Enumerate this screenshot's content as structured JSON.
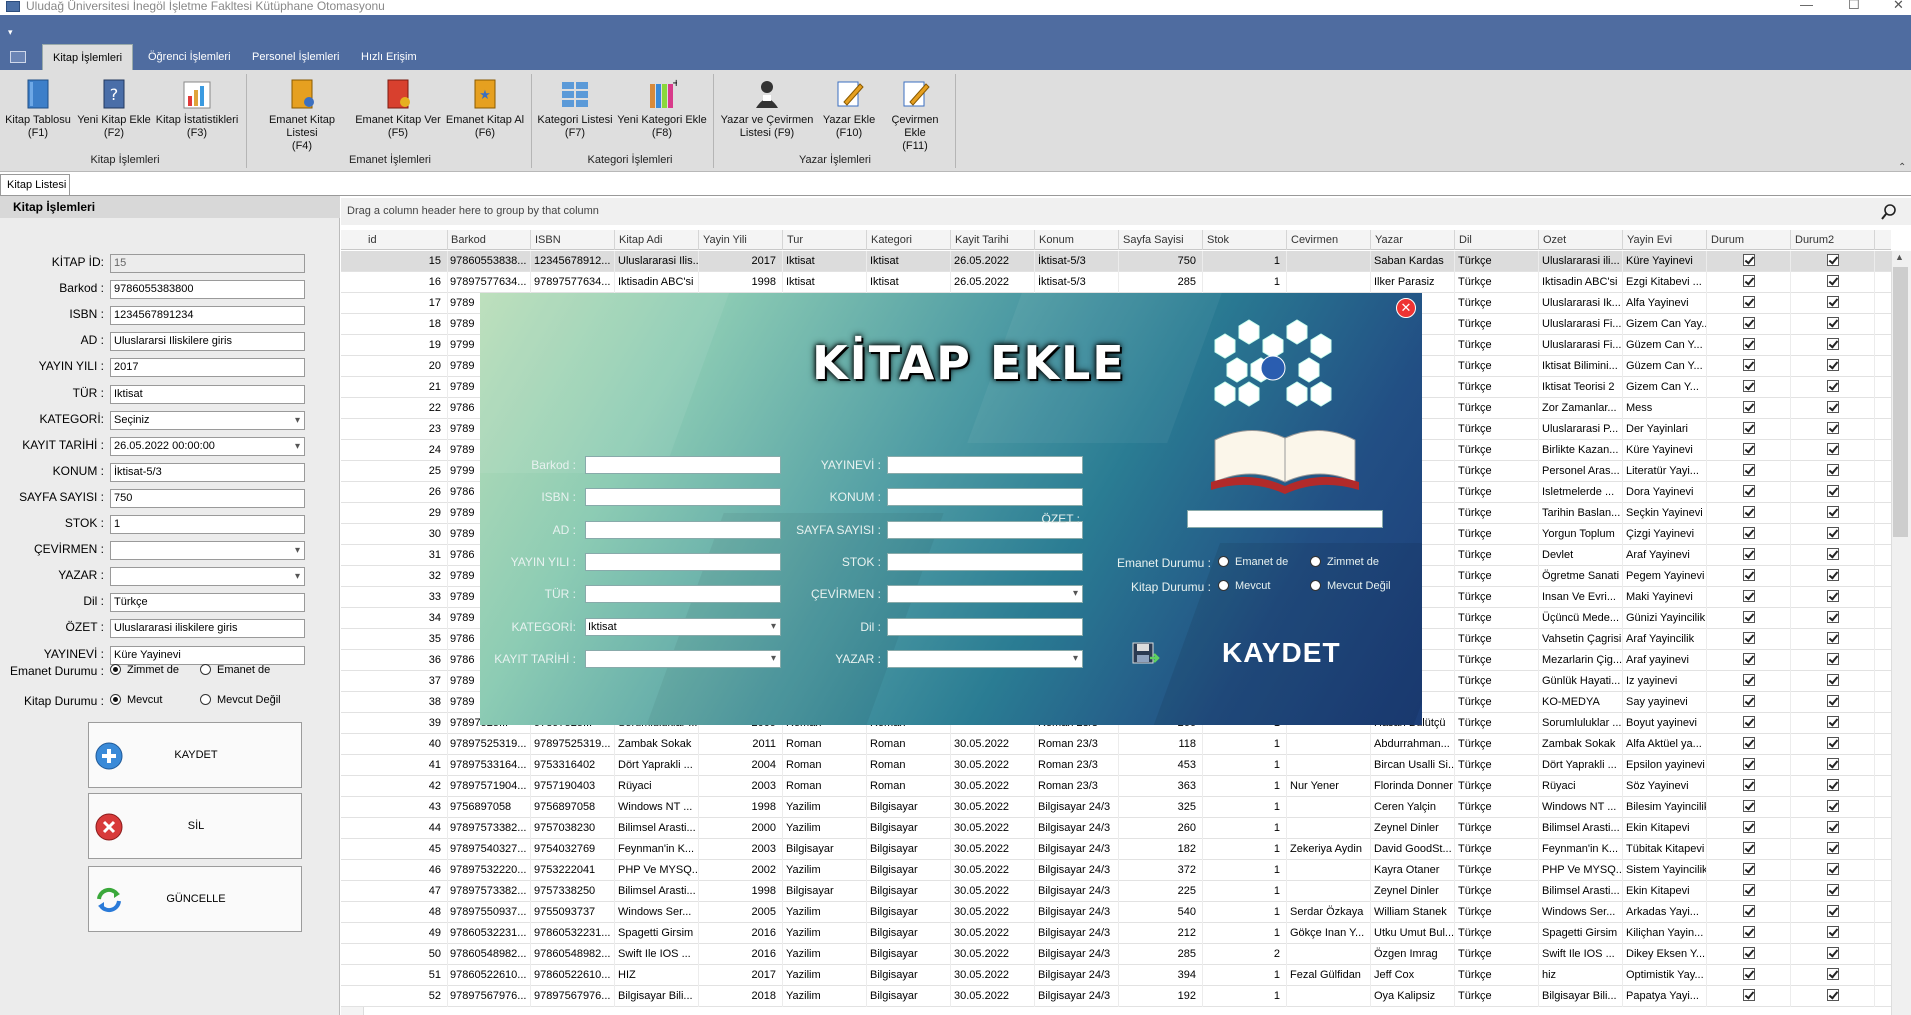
{
  "window": {
    "title": "Uludağ Üniversitesi İnegöl İşletme Fakltesi Kütüphane Otomasyonu"
  },
  "ribbon": {
    "qat": "▾",
    "tabs": [
      "Kitap İşlemleri",
      "Öğrenci İşlemleri",
      "Personel İşlemleri",
      "Hızlı Erişim"
    ],
    "buttons": [
      {
        "l1": "Kitap Tablosu",
        "l2": "(F1)"
      },
      {
        "l1": "Yeni Kitap Ekle",
        "l2": "(F2)"
      },
      {
        "l1": "Kitap İstatistikleri",
        "l2": "(F3)"
      },
      {
        "l1": "Emanet Kitap Listesi",
        "l2": "(F4)"
      },
      {
        "l1": "Emanet Kitap Ver",
        "l2": "(F5)"
      },
      {
        "l1": "Emanet Kitap Al",
        "l2": "(F6)"
      },
      {
        "l1": "Kategori Listesi",
        "l2": "(F7)"
      },
      {
        "l1": "Yeni Kategori Ekle",
        "l2": "(F8)"
      },
      {
        "l1": "Yazar ve Çevirmen",
        "l2": "Listesi (F9)"
      },
      {
        "l1": "Yazar Ekle",
        "l2": "(F10)"
      },
      {
        "l1": "Çevirmen Ekle",
        "l2": "(F11)"
      }
    ],
    "groups": [
      "Kitap İşlemleri",
      "Emanet İşlemleri",
      "Kategori İşlemleri",
      "Yazar İşlemleri"
    ]
  },
  "doctab": "Kitap Listesi",
  "left": {
    "header": "Kitap İşlemleri",
    "fields": [
      {
        "label": "KİTAP İD:",
        "value": "15"
      },
      {
        "label": "Barkod :",
        "value": "9786055383800"
      },
      {
        "label": "ISBN :",
        "value": "1234567891234"
      },
      {
        "label": "AD :",
        "value": "Uluslararsi Iliskilere giris"
      },
      {
        "label": "YAYIN YILI :",
        "value": "2017"
      },
      {
        "label": "TÜR :",
        "value": "Iktisat"
      },
      {
        "label": "KATEGORİ:",
        "value": "Seçiniz"
      },
      {
        "label": "KAYIT TARİHİ :",
        "value": "26.05.2022 00:00:00"
      },
      {
        "label": "KONUM :",
        "value": "İktisat-5/3"
      },
      {
        "label": "SAYFA SAYISI :",
        "value": "750"
      },
      {
        "label": "STOK :",
        "value": "1"
      },
      {
        "label": "ÇEVİRMEN :",
        "value": ""
      },
      {
        "label": "YAZAR :",
        "value": ""
      },
      {
        "label": "Dil :",
        "value": "Türkçe"
      },
      {
        "label": "ÖZET :",
        "value": "Uluslararasi iliskilere giris"
      },
      {
        "label": "YAYINEVİ :",
        "value": "Küre Yayinevi"
      }
    ],
    "emanet_label": "Emanet Durumu :",
    "emanet_opt1": "Zimmet de",
    "emanet_opt2": "Emanet de",
    "kitap_label": "Kitap Durumu :",
    "kitap_opt1": "Mevcut",
    "kitap_opt2": "Mevcut Değil",
    "btn_kaydet": "KAYDET",
    "btn_sil": "SİL",
    "btn_guncelle": "GÜNCELLE"
  },
  "grid": {
    "group_hint": "Drag a column header here to group by that column",
    "columns": [
      "id",
      "Barkod",
      "ISBN",
      "Kitap Adi",
      "Yayin Yili",
      "Tur",
      "Kategori",
      "Kayit Tarihi",
      "Konum",
      "Sayfa Sayisi",
      "Stok",
      "Cevirmen",
      "Yazar",
      "Dil",
      "Ozet",
      "Yayin Evi",
      "Durum",
      "Durum2"
    ],
    "rows": [
      [
        "15",
        "97860553838...",
        "12345678912...",
        "Uluslararasi Ilis...",
        "2017",
        "Iktisat",
        "Iktisat",
        "26.05.2022",
        "İktisat-5/3",
        "750",
        "1",
        "",
        "Saban Kardas",
        "Türkçe",
        "Uluslararasi ili...",
        "Küre Yayinevi"
      ],
      [
        "16",
        "97897577634...",
        "97897577634...",
        "Iktisadin ABC'si",
        "1998",
        "Iktisat",
        "Iktisat",
        "26.05.2022",
        "İktisat-5/3",
        "285",
        "1",
        "",
        "Ilker Parasiz",
        "Türkçe",
        "Iktisadin ABC'si",
        "Ezgi Kitabevi ..."
      ],
      [
        "17",
        "9789",
        "",
        "",
        "",
        "",
        "",
        "",
        "",
        "",
        "",
        "",
        "rk",
        "Türkçe",
        "Uluslararasi Ik...",
        "Alfa Yayinevi"
      ],
      [
        "18",
        "9789",
        "",
        "",
        "",
        "",
        "",
        "",
        "",
        "",
        "",
        "",
        "doglu",
        "Türkçe",
        "Uluslararasi Fi...",
        "Gizem Can Yay..."
      ],
      [
        "19",
        "9799",
        "",
        "",
        "",
        "",
        "",
        "",
        "",
        "",
        "",
        "",
        "doglu",
        "Türkçe",
        "Uluslararasi Fi...",
        "Güzem Can Y..."
      ],
      [
        "20",
        "9789",
        "",
        "",
        "",
        "",
        "",
        "",
        "",
        "",
        "",
        "",
        "doglu",
        "Türkçe",
        "Iktisat Bilimini...",
        "Güzem Can Y..."
      ],
      [
        "21",
        "9789",
        "",
        "",
        "",
        "",
        "",
        "",
        "",
        "",
        "",
        "",
        "sz",
        "Türkçe",
        "Iktisat Teorisi 2",
        "Gizem Can Y..."
      ],
      [
        "22",
        "9786",
        "",
        "",
        "",
        "",
        "",
        "",
        "",
        "",
        "",
        "",
        "",
        "Türkçe",
        "Zor Zamanlar...",
        "Mess"
      ],
      [
        "23",
        "9789",
        "",
        "",
        "",
        "",
        "",
        "",
        "",
        "",
        "",
        "",
        "ngiz",
        "Türkçe",
        "Uluslararasi P...",
        "Der Yayinlari"
      ],
      [
        "24",
        "9789",
        "",
        "",
        "",
        "",
        "",
        "",
        "",
        "",
        "",
        "",
        "",
        "Türkçe",
        "Birlikte Kazan...",
        "Küre Yayinevi"
      ],
      [
        "25",
        "9799",
        "",
        "",
        "",
        "",
        "",
        "",
        "",
        "",
        "",
        "",
        "zisik",
        "Türkçe",
        "Personel Aras...",
        "Literatür Yayi..."
      ],
      [
        "26",
        "9786",
        "",
        "",
        "",
        "",
        "",
        "",
        "",
        "",
        "",
        "",
        "",
        "Türkçe",
        "Isletmelerde ...",
        "Dora Yayinevi"
      ],
      [
        "29",
        "9789",
        "",
        "",
        "",
        "",
        "",
        "",
        "",
        "",
        "",
        "",
        "aos",
        "Türkçe",
        "Tarihin Baslan...",
        "Seçkin Yayinevi"
      ],
      [
        "30",
        "9789",
        "",
        "",
        "",
        "",
        "",
        "",
        "",
        "",
        "",
        "",
        "ahadir",
        "Türkçe",
        "Yorgun Toplum",
        "Çizgi Yayinevi"
      ],
      [
        "31",
        "9786",
        "",
        "",
        "",
        "",
        "",
        "",
        "",
        "",
        "",
        "",
        "",
        "Türkçe",
        "Devlet",
        "Araf Yayinevi"
      ],
      [
        "32",
        "9789",
        "",
        "",
        "",
        "",
        "",
        "",
        "",
        "",
        "",
        "",
        "mirel",
        "Türkçe",
        "Ögretme Sanati",
        "Pegem Yayinevi"
      ],
      [
        "33",
        "9789",
        "",
        "",
        "",
        "",
        "",
        "",
        "",
        "",
        "",
        "",
        "nel",
        "Türkçe",
        "Insan Ve Evri...",
        "Maki Yayinevi"
      ],
      [
        "34",
        "9789",
        "",
        "",
        "",
        "",
        "",
        "",
        "",
        "",
        "",
        "",
        "emir",
        "Türkçe",
        "Üçüncü Mede...",
        "Günizi Yayincilik"
      ],
      [
        "35",
        "9786",
        "",
        "",
        "",
        "",
        "",
        "",
        "",
        "",
        "",
        "",
        "lon",
        "Türkçe",
        "Vahsetin Çagrisi",
        "Araf Yayincilik"
      ],
      [
        "36",
        "9786",
        "",
        "",
        "",
        "",
        "",
        "",
        "",
        "",
        "",
        "",
        "lon",
        "Türkçe",
        "Mezarlarin Çig...",
        "Araf yayinevi"
      ],
      [
        "37",
        "9789",
        "",
        "",
        "",
        "",
        "",
        "",
        "",
        "",
        "",
        "",
        "n Ka...",
        "Türkçe",
        "Günlük Hayati...",
        "Iz yayinevi"
      ],
      [
        "38",
        "9789",
        "",
        "",
        "",
        "",
        "",
        "",
        "",
        "",
        "",
        "",
        "tsen",
        "Türkçe",
        "KO-MEDYA",
        "Say yayinevi"
      ],
      [
        "39",
        "97897525...",
        "97897525...",
        "Sorumluluklar ...",
        "2009",
        "Roman",
        "Roman",
        "",
        "Roman 23/3",
        "266",
        "1",
        "",
        "Hasan Bülütçü",
        "Türkçe",
        "Sorumluluklar ...",
        "Boyut yayinevi"
      ],
      [
        "40",
        "97897525319...",
        "97897525319...",
        "Zambak Sokak",
        "2011",
        "Roman",
        "Roman",
        "30.05.2022",
        "Roman 23/3",
        "118",
        "1",
        "",
        "Abdurrahman...",
        "Türkçe",
        "Zambak Sokak",
        "Alfa Aktüel ya..."
      ],
      [
        "41",
        "97897533164...",
        "9753316402",
        "Dört Yaprakli ...",
        "2004",
        "Roman",
        "Roman",
        "30.05.2022",
        "Roman 23/3",
        "453",
        "1",
        "",
        "Bircan Usalli Si...",
        "Türkçe",
        "Dört Yaprakli ...",
        "Epsilon yayinevi"
      ],
      [
        "42",
        "97897571904...",
        "9757190403",
        "Rüyaci",
        "2003",
        "Roman",
        "Roman",
        "30.05.2022",
        "Roman 23/3",
        "363",
        "1",
        "Nur Yener",
        "Florinda Donner",
        "Türkçe",
        "Rüyaci",
        "Söz Yayinevi"
      ],
      [
        "43",
        "9756897058",
        "9756897058",
        "Windows NT ...",
        "1998",
        "Yazilim",
        "Bilgisayar",
        "30.05.2022",
        "Bilgisayar 24/3",
        "325",
        "1",
        "",
        "Ceren Yalçin",
        "Türkçe",
        "Windows NT ...",
        "Bilesim Yayincilik"
      ],
      [
        "44",
        "97897573382...",
        "9757038230",
        "Bilimsel Arasti...",
        "2000",
        "Yazilim",
        "Bilgisayar",
        "30.05.2022",
        "Bilgisayar 24/3",
        "260",
        "1",
        "",
        "Zeynel Dinler",
        "Türkçe",
        "Bilimsel Arasti...",
        "Ekin Kitapevi"
      ],
      [
        "45",
        "97897540327...",
        "9754032769",
        "Feynman'in K...",
        "2003",
        "Bilgisayar",
        "Bilgisayar",
        "30.05.2022",
        "Bilgisayar 24/3",
        "182",
        "1",
        "Zekeriya Aydin",
        "David GoodSt...",
        "Türkçe",
        "Feynman'in K...",
        "Tübitak Kitapevi"
      ],
      [
        "46",
        "97897532220...",
        "9753222041",
        "PHP Ve MYSQ...",
        "2002",
        "Yazilim",
        "Bilgisayar",
        "30.05.2022",
        "Bilgisayar 24/3",
        "372",
        "1",
        "",
        "Kayra Otaner",
        "Türkçe",
        "PHP Ve MYSQ...",
        "Sistem Yayincilik"
      ],
      [
        "47",
        "97897573382...",
        "9757338250",
        "Bilimsel Arasti...",
        "1998",
        "Bilgisayar",
        "Bilgisayar",
        "30.05.2022",
        "Bilgisayar 24/3",
        "225",
        "1",
        "",
        "Zeynel Dinler",
        "Türkçe",
        "Bilimsel Arasti...",
        "Ekin Kitapevi"
      ],
      [
        "48",
        "97897550937...",
        "9755093737",
        "Windows Ser...",
        "2005",
        "Yazilim",
        "Bilgisayar",
        "30.05.2022",
        "Bilgisayar 24/3",
        "540",
        "1",
        "Serdar Özkaya",
        "William Stanek",
        "Türkçe",
        "Windows Ser...",
        "Arkadas Yayi..."
      ],
      [
        "49",
        "97860532231...",
        "97860532231...",
        "Spagetti Girsim",
        "2016",
        "Yazilim",
        "Bilgisayar",
        "30.05.2022",
        "Bilgisayar 24/3",
        "212",
        "1",
        "Gökçe Inan Y...",
        "Utku Umut Bul...",
        "Türkçe",
        "Spagetti Girsim",
        "Kiliçhan Yayin..."
      ],
      [
        "50",
        "97860548982...",
        "97860548982...",
        "Swift Ile IOS ...",
        "2016",
        "Yazilim",
        "Bilgisayar",
        "30.05.2022",
        "Bilgisayar 24/3",
        "285",
        "2",
        "",
        "Özgen Imrag",
        "Türkçe",
        "Swift Ile IOS ...",
        "Dikey Eksen Y..."
      ],
      [
        "51",
        "97860522610...",
        "97860522610...",
        "HIZ",
        "2017",
        "Yazilim",
        "Bilgisayar",
        "30.05.2022",
        "Bilgisayar 24/3",
        "394",
        "1",
        "Fezal Gülfidan",
        "Jeff Cox",
        "Türkçe",
        "hiz",
        "Optimistik Yay..."
      ],
      [
        "52",
        "97897567976...",
        "97897567976...",
        "Bilgisayar Bili...",
        "2018",
        "Yazilim",
        "Bilgisayar",
        "30.05.2022",
        "Bilgisayar 24/3",
        "192",
        "1",
        "",
        "Oya Kalipsiz",
        "Türkçe",
        "Bilgisayar Bili...",
        "Papatya Yayi..."
      ]
    ]
  },
  "modal": {
    "title": "KİTAP EKLE",
    "left_labels": [
      "Barkod :",
      "ISBN :",
      "AD :",
      "YAYIN YILI :",
      "TÜR :",
      "KATEGORİ:",
      "KAYIT TARİHİ :"
    ],
    "kategori_value": "Iktisat",
    "mid_labels": [
      "YAYINEVİ :",
      "KONUM :",
      "SAYFA SAYISI :",
      "STOK :",
      "ÇEVİRMEN :",
      "Dil :",
      "YAZAR :"
    ],
    "ozet_label": "ÖZET :",
    "emanet_label": "Emanet Durumu :",
    "emanet_opt1": "Emanet de",
    "emanet_opt2": "Zimmet de",
    "kitap_label": "Kitap Durumu :",
    "kitap_opt1": "Mevcut",
    "kitap_opt2": "Mevcut Değil",
    "save": "KAYDET",
    "close": "✕"
  }
}
